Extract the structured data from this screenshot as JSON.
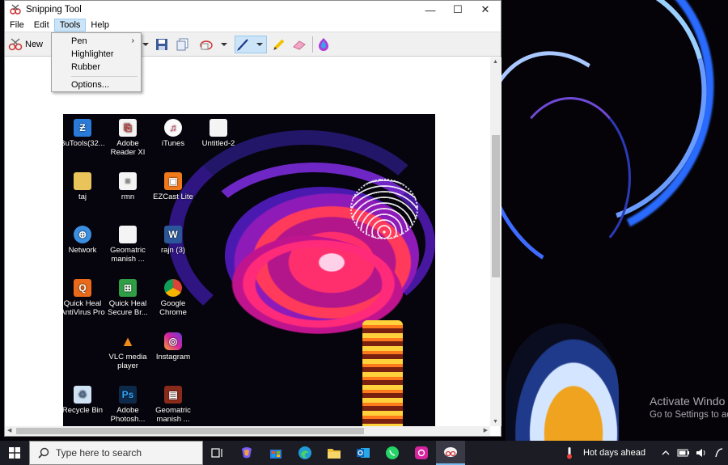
{
  "window": {
    "title": "Snipping Tool",
    "minimize": "—",
    "maximize": "☐",
    "close": "✕"
  },
  "menubar": {
    "items": [
      "File",
      "Edit",
      "Tools",
      "Help"
    ]
  },
  "toolbar": {
    "new_label": "New"
  },
  "tools_menu": {
    "pen": "Pen",
    "pen_arrow": "›",
    "highlighter": "Highlighter",
    "rubber": "Rubber",
    "options": "Options..."
  },
  "snip_icons": [
    {
      "label": "BuTools(32...",
      "color": "#2a7ad8"
    },
    {
      "label": "Adobe Reader XI",
      "color": "#f4f4f4"
    },
    {
      "label": "iTunes",
      "color": "#fafafa"
    },
    {
      "label": "Untitled-2",
      "color": "#f4f4f4"
    },
    {
      "label": "taj",
      "color": "#e8c45a"
    },
    {
      "label": "rmn",
      "color": "#f4f4f4"
    },
    {
      "label": "EZCast Lite",
      "color": "#f07a1a"
    },
    {
      "label": "Network",
      "color": "#3b8ee0"
    },
    {
      "label": "Geomatric manish ...",
      "color": "#f4f4f4"
    },
    {
      "label": "rajn (3)",
      "color": "#2b579a"
    },
    {
      "label": "Quick Heal AntiVirus Pro",
      "color": "#e86a1a"
    },
    {
      "label": "Quick Heal Secure Br...",
      "color": "#2f9e44"
    },
    {
      "label": "Google Chrome",
      "color": "#ffffff"
    },
    {
      "label": "VLC media player",
      "color": "#f08a1a"
    },
    {
      "label": "Instagram",
      "color": "#d6249f"
    },
    {
      "label": "Recycle Bin",
      "color": "#cfe3f5"
    },
    {
      "label": "Adobe Photosh...",
      "color": "#0e2a4a"
    },
    {
      "label": "Geomatric manish ...",
      "color": "#8a2a1a"
    }
  ],
  "watermark": {
    "title": "Activate Windo",
    "subtitle": "Go to Settings to ac"
  },
  "taskbar": {
    "search_placeholder": "Type here to search",
    "weather": "Hot days ahead"
  }
}
